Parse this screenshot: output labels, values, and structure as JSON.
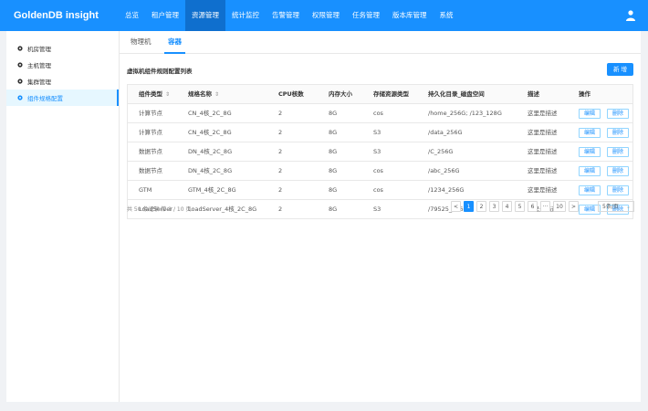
{
  "app": {
    "title": "GoldenDB insight"
  },
  "nav": [
    "总览",
    "租户管理",
    "资源管理",
    "统计监控",
    "告警管理",
    "权限管理",
    "任务管理",
    "版本库管理",
    "系统"
  ],
  "sidebar": [
    "机房管理",
    "主机管理",
    "集群管理",
    "组件规格配置"
  ],
  "tabs": [
    "物理机",
    "容器"
  ],
  "section_title": "虚拟机组件规则配置列表",
  "new_button": "新 增",
  "table": {
    "headers": [
      "组件类型",
      "规格名称",
      "CPU核数",
      "内存大小",
      "存储资源类型",
      "持久化目录_磁盘空间",
      "描述",
      "操作"
    ],
    "sort_glyph": "⇕",
    "rows": [
      [
        "计算节点",
        "CN_4核_2C_8G",
        "2",
        "8G",
        "cos",
        "/home_256G; /123_128G",
        "这里是描述"
      ],
      [
        "计算节点",
        "CN_4核_2C_8G",
        "2",
        "8G",
        "S3",
        "/data_256G",
        "这里是描述"
      ],
      [
        "数据节点",
        "DN_4核_2C_8G",
        "2",
        "8G",
        "S3",
        "/C_256G",
        "这里是描述"
      ],
      [
        "数据节点",
        "DN_4核_2C_8G",
        "2",
        "8G",
        "cos",
        "/abc_256G",
        "这里是描述"
      ],
      [
        "GTM",
        "GTM_4核_2C_8G",
        "2",
        "8G",
        "cos",
        "/1234_256G",
        "这里是描述"
      ],
      [
        "LoadServer",
        "LoadServer_4核_2C_8G",
        "2",
        "8G",
        "S3",
        "/79525_256G",
        "这里是描述"
      ]
    ],
    "edit_label": "编辑",
    "delete_label": "删除"
  },
  "pagination": {
    "total_text": "共 50 条记录 第 1 / 10 页",
    "prev": "<",
    "pages": [
      "1",
      "2",
      "3",
      "4",
      "5",
      "6",
      "···",
      "10"
    ],
    "next": ">",
    "page_size": "5条/页",
    "current": "1"
  },
  "colors": {
    "primary": "#1890ff",
    "header_bg": "#1890ff"
  },
  "icons": {
    "user": "user-icon",
    "menu": "gear-icon"
  }
}
